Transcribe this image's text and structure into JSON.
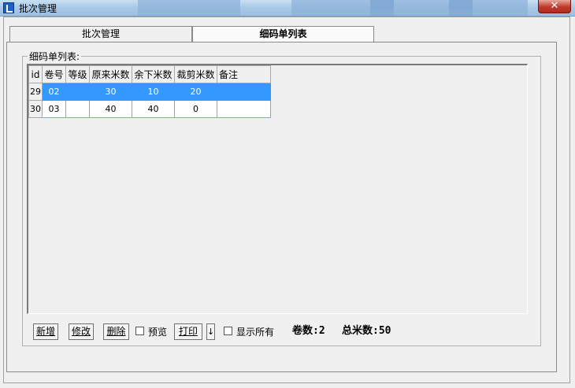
{
  "window": {
    "title": "批次管理",
    "close_glyph": "✕"
  },
  "tabs": [
    {
      "label": "批次管理",
      "active": false
    },
    {
      "label": "细码单列表",
      "active": true
    }
  ],
  "group": {
    "label": "细码单列表:"
  },
  "grid": {
    "columns": [
      "id",
      "卷号",
      "等级",
      "原来米数",
      "余下米数",
      "裁剪米数",
      "备注"
    ],
    "rows": [
      {
        "id": "29",
        "roll": "02",
        "grade": "",
        "original": "30",
        "remaining": "10",
        "cut": "20",
        "remark": "",
        "selected": true
      },
      {
        "id": "30",
        "roll": "03",
        "grade": "",
        "original": "40",
        "remaining": "40",
        "cut": "0",
        "remark": "",
        "selected": false
      }
    ]
  },
  "toolbar": {
    "add_label": "新增",
    "edit_label": "修改",
    "delete_label": "删除",
    "preview_label": "预览",
    "print_label": "打印",
    "print_menu_glyph": "↓",
    "show_all_label": "显示所有",
    "preview_checked": false,
    "show_all_checked": false
  },
  "summary": {
    "roll_count_text": "卷数:2",
    "total_meters_text": "总米数:50"
  },
  "colors": {
    "selection": "#3399ff",
    "close_button": "#c0392b"
  }
}
